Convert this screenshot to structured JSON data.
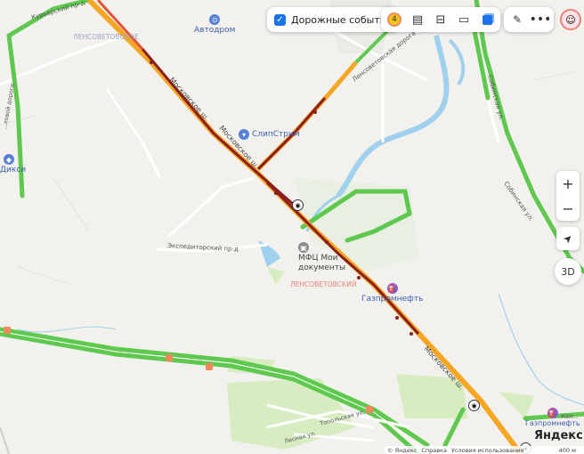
{
  "toolbar": {
    "traffic_events_label": "Дорожные события",
    "traffic_level": "4"
  },
  "districts": {
    "top": "ЛЕНСОВЕТОВСКОЕ",
    "center": "ЛЕНСОВЕТОВСКИЙ"
  },
  "streets": {
    "kurierskiy": "Курьерский пр-д",
    "moskovskoe1": "Московское ш.",
    "moskovskoe2": "Московское ш.",
    "moskovskoe3": "Московское ш.",
    "lensovetovskaya": "Ленсоветовская дорога",
    "sobinovskaya": "Собинская ул.",
    "sobinovskaya2": "Собинская ул.",
    "ekspeditorskiy": "Экспедиторский пр-д",
    "topolskaya": "Топольская ул.",
    "lesnaya": "Лесная ул.",
    "leftroad": "...ловой дороге",
    "kol": "Кол..."
  },
  "pois": {
    "avtodrom": "Автодром",
    "sliptstrim": "СлипСтрим",
    "diksi": "Дикси",
    "mfc": "МФЦ Мои документы",
    "gazpromneft": "Газпромнефть",
    "gazpromneft2": "Газпромнефть"
  },
  "controls": {
    "zoom_in": "+",
    "zoom_out": "−",
    "mode_3d": "3D"
  },
  "footer": {
    "brand": "Яндекс",
    "copyright": "© Яндекс",
    "help": "Справка",
    "terms": "Условия использования",
    "scale": "400 м"
  },
  "colors": {
    "jam_red": "#8b1e1e",
    "jam_orange": "#f5a623",
    "free_green": "#5ec94e",
    "water": "#9fd1ee",
    "accent": "#1a73e8"
  }
}
